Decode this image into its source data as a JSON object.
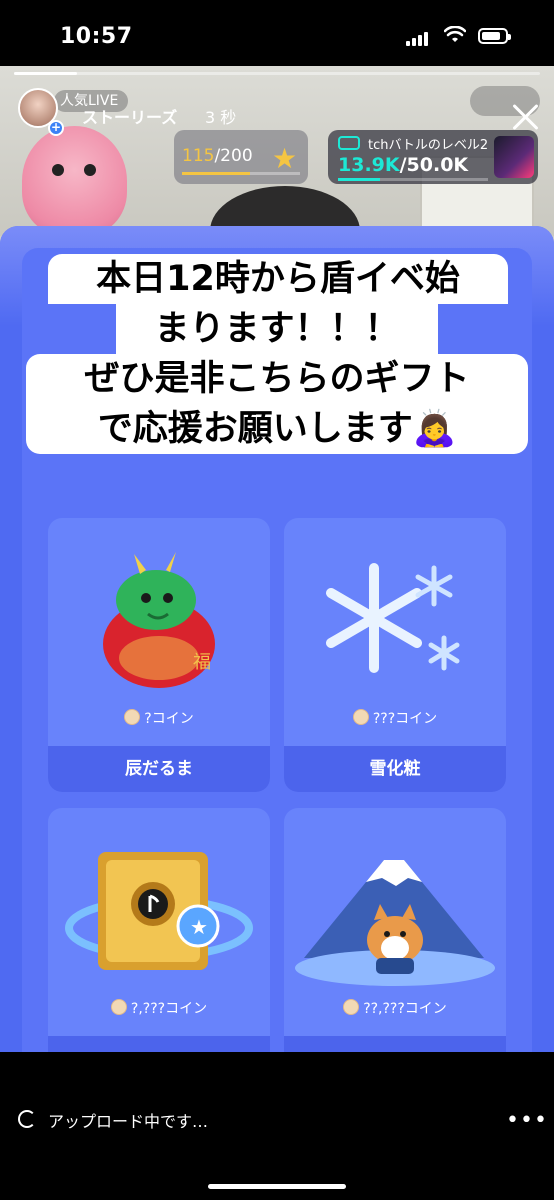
{
  "status_bar": {
    "time": "10:57",
    "icons": [
      "cellular-signal-icon",
      "wifi-icon",
      "battery-icon"
    ]
  },
  "story": {
    "live_badge": "人気LIVE",
    "account_label": "ストーリーズ",
    "time_ago": "3 秒",
    "star_progress": {
      "current": "115",
      "total": "/200",
      "fraction": 0.575
    },
    "battle_progress": {
      "title": "tchバトルのレベル2",
      "current": "13.9K",
      "total": "/50.0K",
      "fraction": 0.278
    },
    "caption_lines": [
      "本日12時から盾イベ始",
      "まります！！！",
      "ぜひ是非こちらのギフト",
      "で応援お願いします🙇‍♀️"
    ]
  },
  "gifts": [
    {
      "name": "辰だるま",
      "price": "?コイン"
    },
    {
      "name": "雪化粧",
      "price": "???コイン"
    },
    {
      "name": "",
      "price": "?,???コイン"
    },
    {
      "name": "",
      "price": "??,???コイン"
    }
  ],
  "bottom_bar": {
    "upload_status": "アップロード中です…",
    "more_label": "•••"
  }
}
